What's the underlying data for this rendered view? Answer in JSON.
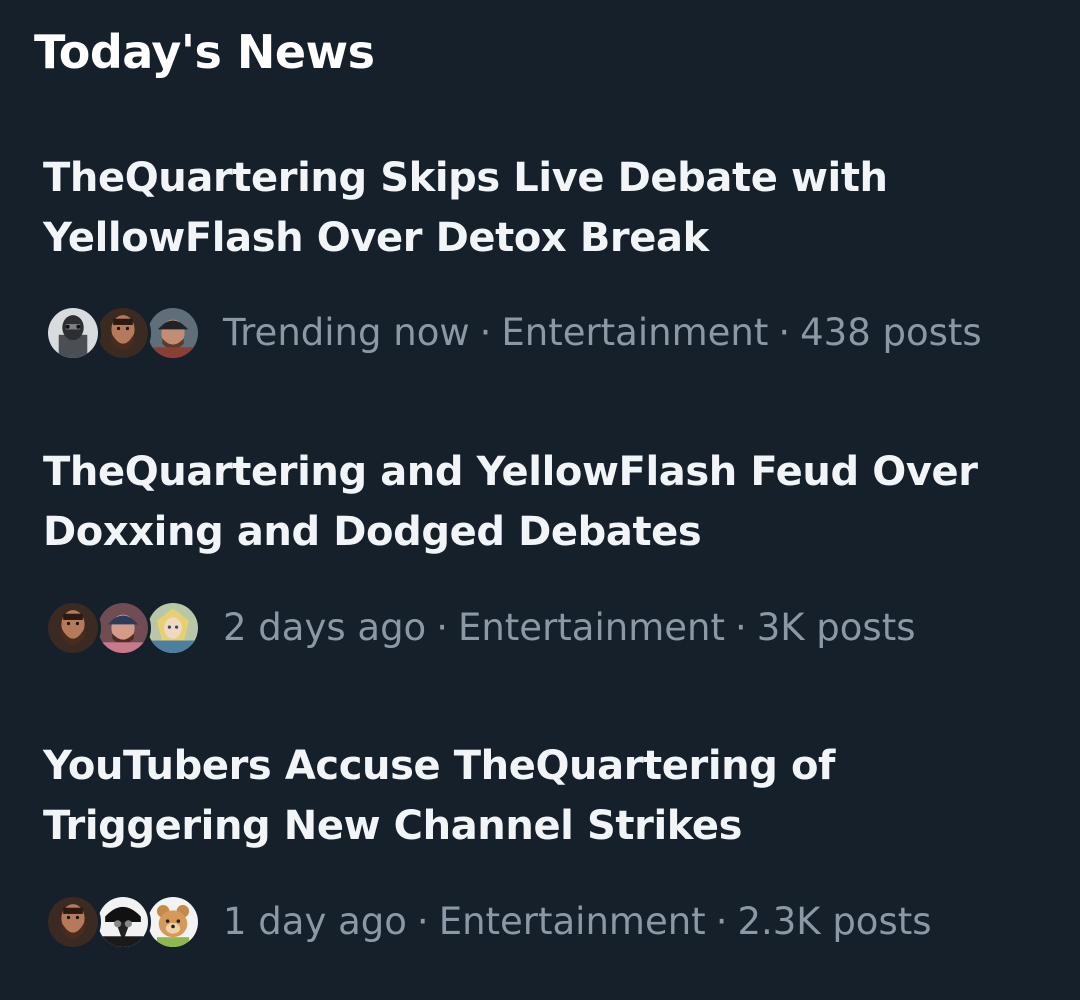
{
  "section": {
    "title": "Today's News"
  },
  "news": [
    {
      "headline": "TheQuartering Skips Live Debate with YellowFlash Over Detox Break",
      "time": "Trending now",
      "category": "Entertainment",
      "posts": "438 posts",
      "avatars": [
        "masked-figure-avatar",
        "bearded-man-avatar",
        "man-with-cap-avatar"
      ]
    },
    {
      "headline": "TheQuartering and YellowFlash Feud Over Doxxing and Dodged Debates",
      "time": "2 days ago",
      "category": "Entertainment",
      "posts": "3K posts",
      "avatars": [
        "bearded-man-avatar",
        "man-with-cap-avatar",
        "anime-character-avatar"
      ]
    },
    {
      "headline": "YouTubers Accuse TheQuartering of Triggering New Channel Strikes",
      "time": "1 day ago",
      "category": "Entertainment",
      "posts": "2.3K posts",
      "avatars": [
        "bearded-man-avatar",
        "plague-doctor-avatar",
        "cartoon-bear-avatar"
      ]
    }
  ],
  "separator": "·",
  "colors": {
    "background": "#16202b",
    "headline": "#f2f5f7",
    "meta": "#8b98a5"
  }
}
